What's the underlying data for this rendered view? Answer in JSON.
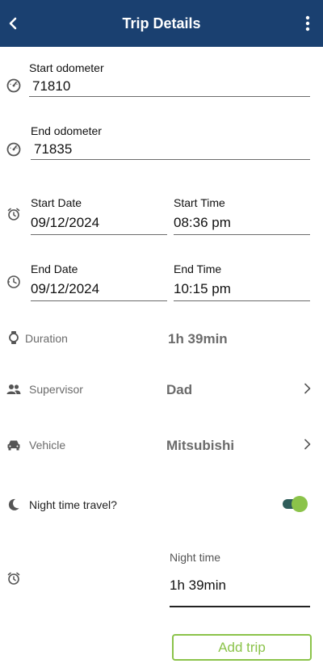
{
  "header": {
    "title": "Trip Details"
  },
  "fields": {
    "start_odometer": {
      "label": "Start odometer",
      "value": "71810"
    },
    "end_odometer": {
      "label": "End odometer",
      "value": "71835"
    },
    "start_date": {
      "label": "Start Date",
      "value": "09/12/2024"
    },
    "start_time": {
      "label": "Start Time",
      "value": "08:36 pm"
    },
    "end_date": {
      "label": "End Date",
      "value": "09/12/2024"
    },
    "end_time": {
      "label": "End Time",
      "value": "10:15 pm"
    }
  },
  "rows": {
    "duration": {
      "label": "Duration",
      "value": "1h 39min"
    },
    "supervisor": {
      "label": "Supervisor",
      "value": "Dad"
    },
    "vehicle": {
      "label": "Vehicle",
      "value": "Mitsubishi"
    },
    "night_travel": {
      "label": "Night time travel?",
      "enabled": true
    },
    "night_time": {
      "label": "Night time",
      "value": "1h 39min"
    }
  },
  "actions": {
    "add_trip": "Add trip"
  },
  "colors": {
    "header": "#1a4070",
    "accent": "#8bc34a",
    "toggle_track": "#2f5d5a"
  },
  "icons": [
    "back-arrow-icon",
    "more-vert-icon",
    "speedometer-icon",
    "alarm-icon",
    "clock-icon",
    "watch-icon",
    "people-icon",
    "car-icon",
    "moon-icon",
    "chevron-right-icon"
  ]
}
